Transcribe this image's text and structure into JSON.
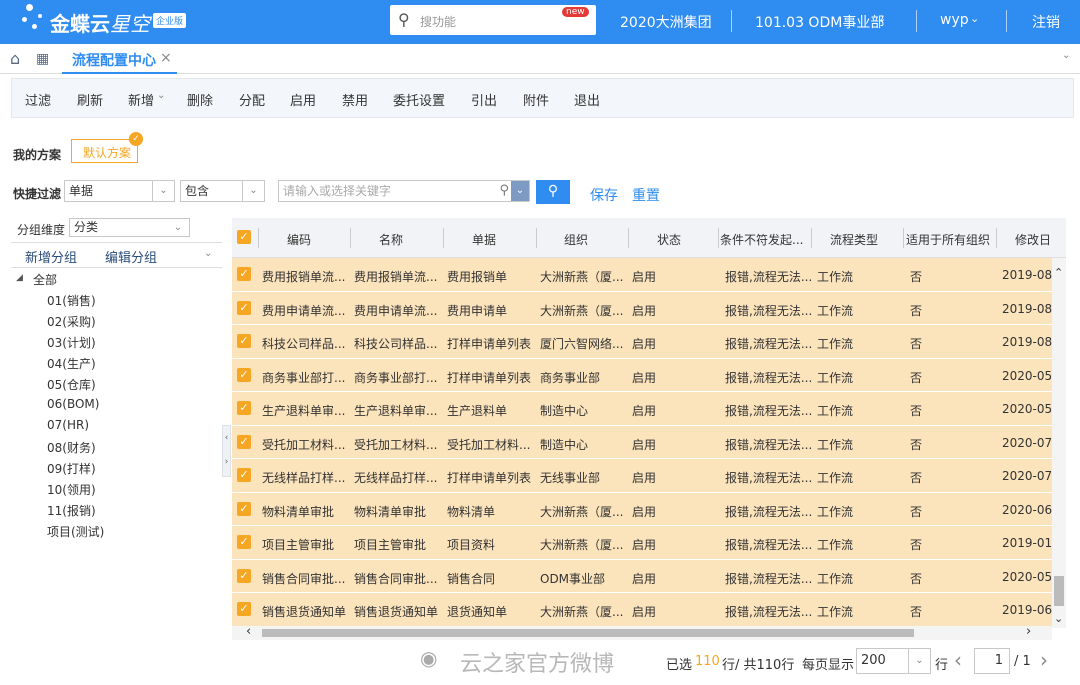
{
  "header": {
    "logo_text": "金蝶云",
    "logo_sub": "星空",
    "edition_badge": "企业版",
    "search_placeholder": "搜功能",
    "new_badge": "new",
    "org": "2020大洲集团",
    "dept": "101.03 ODM事业部",
    "user": "wyp",
    "logout": "注销"
  },
  "tabs": [
    {
      "label": "流程配置中心",
      "close": "×"
    }
  ],
  "toolbar": [
    "过滤",
    "刷新",
    "新增",
    "删除",
    "分配",
    "启用",
    "禁用",
    "委托设置",
    "引出",
    "附件",
    "退出"
  ],
  "scheme": {
    "label": "我的方案",
    "default": "默认方案"
  },
  "quick_filter": {
    "label": "快捷过滤",
    "field": "单据",
    "op": "包含",
    "placeholder": "请输入或选择关键字",
    "save": "保存",
    "reset": "重置"
  },
  "group": {
    "dim_label": "分组维度",
    "dim_value": "分类",
    "add": "新增分组",
    "edit": "编辑分组",
    "root": "全部",
    "items": [
      "01(销售)",
      "02(采购)",
      "03(计划)",
      "04(生产)",
      "05(仓库)",
      "06(BOM)",
      "07(HR)",
      "08(财务)",
      "09(打样)",
      "10(领用)",
      "11(报销)",
      "项目(测试)"
    ]
  },
  "grid": {
    "columns": [
      "编码",
      "名称",
      "单据",
      "组织",
      "状态",
      "条件不符发起...",
      "流程类型",
      "适用于所有组织",
      "修改日"
    ],
    "rows": [
      [
        "费用报销单流...",
        "费用报销单流...",
        "费用报销单",
        "大洲新燕（厦...",
        "启用",
        "报错,流程无法...",
        "工作流",
        "否",
        "2019-08"
      ],
      [
        "费用申请单流...",
        "费用申请单流...",
        "费用申请单",
        "大洲新燕（厦...",
        "启用",
        "报错,流程无法...",
        "工作流",
        "否",
        "2019-08"
      ],
      [
        "科技公司样品...",
        "科技公司样品...",
        "打样申请单列表",
        "厦门六智网络...",
        "启用",
        "报错,流程无法...",
        "工作流",
        "否",
        "2019-08"
      ],
      [
        "商务事业部打...",
        "商务事业部打...",
        "打样申请单列表",
        "商务事业部",
        "启用",
        "报错,流程无法...",
        "工作流",
        "否",
        "2020-05"
      ],
      [
        "生产退料单审...",
        "生产退料单审...",
        "生产退料单",
        "制造中心",
        "启用",
        "报错,流程无法...",
        "工作流",
        "否",
        "2020-05"
      ],
      [
        "受托加工材料...",
        "受托加工材料...",
        "受托加工材料...",
        "制造中心",
        "启用",
        "报错,流程无法...",
        "工作流",
        "否",
        "2020-07"
      ],
      [
        "无线样品打样...",
        "无线样品打样...",
        "打样申请单列表",
        "无线事业部",
        "启用",
        "报错,流程无法...",
        "工作流",
        "否",
        "2020-07"
      ],
      [
        "物料清单审批",
        "物料清单审批",
        "物料清单",
        "大洲新燕（厦...",
        "启用",
        "报错,流程无法...",
        "工作流",
        "否",
        "2020-06"
      ],
      [
        "项目主管审批",
        "项目主管审批",
        "项目资料",
        "大洲新燕（厦...",
        "启用",
        "报错,流程无法...",
        "工作流",
        "否",
        "2019-01"
      ],
      [
        "销售合同审批...",
        "销售合同审批...",
        "销售合同",
        "ODM事业部",
        "启用",
        "报错,流程无法...",
        "工作流",
        "否",
        "2020-05"
      ],
      [
        "销售退货通知单",
        "销售退货通知单",
        "退货通知单",
        "大洲新燕（厦...",
        "启用",
        "报错,流程无法...",
        "工作流",
        "否",
        "2019-06"
      ]
    ]
  },
  "footer": {
    "watermark": "云之家官方微博",
    "selected_prefix": "已选",
    "selected": "110",
    "selected_suffix": "行/ 共110行",
    "per_page_label": "每页显示",
    "per_page": "200",
    "rows_label": "行",
    "page": "1",
    "total_pages": "/ 1"
  },
  "colors": {
    "brand": "#2f8cf0",
    "row_selected": "#fbe3bb",
    "accent": "#f5a623"
  }
}
